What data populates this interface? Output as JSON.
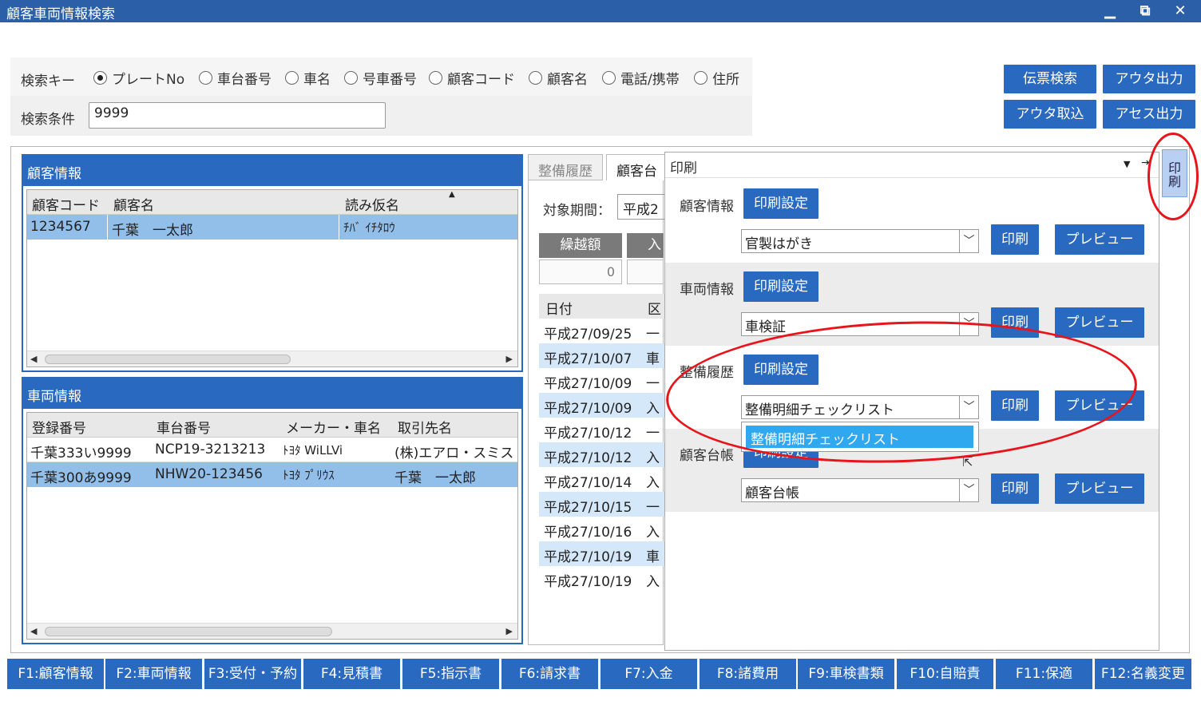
{
  "window": {
    "title": "顧客車両情報検索",
    "minimize": "▁",
    "restore": "⧉",
    "close": "✕"
  },
  "search": {
    "key_label": "検索キー",
    "options": [
      "プレートNo",
      "車台番号",
      "車名",
      "号車番号",
      "顧客コード",
      "顧客名",
      "電話/携帯",
      "住所"
    ],
    "selected": "プレートNo",
    "cond_label": "検索条件",
    "cond_value": "9999"
  },
  "top_buttons": {
    "denpyo": "伝票検索",
    "outer_out": "アウタ出力",
    "outer_in": "アウタ取込",
    "access_out": "アセス出力"
  },
  "customer": {
    "title": "顧客情報",
    "columns": [
      "顧客コード",
      "顧客名",
      "読み仮名"
    ],
    "rows": [
      {
        "code": "1234567",
        "name": "千葉　一太郎",
        "kana": "ﾁﾊﾞ ｲﾁﾀﾛｳ"
      }
    ]
  },
  "vehicle": {
    "title": "車両情報",
    "columns": [
      "登録番号",
      "車台番号",
      "メーカー・車名",
      "取引先名"
    ],
    "rows": [
      {
        "reg": "千葉333い9999",
        "chassis": "NCP19-3213213",
        "maker": "ﾄﾖﾀ WiLLVi",
        "client": "(株)エアロ・スミス"
      },
      {
        "reg": "千葉300あ9999",
        "chassis": "NHW20-123456",
        "maker": "ﾄﾖﾀ ﾌﾟﾘｳｽ",
        "client": "千葉　一太郎"
      }
    ]
  },
  "middle": {
    "tabs": [
      "整備履歴",
      "顧客台"
    ],
    "period_label": "対象期間：",
    "period_value": "平成2",
    "carry_label": "繰越額",
    "in_label": "入",
    "carry_value": "0",
    "col_date": "日付",
    "col_kind": "区",
    "dates": [
      "平成27/09/25",
      "平成27/10/07",
      "平成27/10/09",
      "平成27/10/09",
      "平成27/10/12",
      "平成27/10/12",
      "平成27/10/14",
      "平成27/10/15",
      "平成27/10/16",
      "平成27/10/19",
      "平成27/10/19"
    ],
    "kinds": [
      "一",
      "車",
      "一",
      "入",
      "一",
      "入",
      "入",
      "一",
      "入",
      "車",
      "入"
    ]
  },
  "print": {
    "title": "印刷",
    "side_tab": "印刷",
    "settings_label": "印刷設定",
    "print_label": "印刷",
    "preview_label": "プレビュー",
    "sections": [
      {
        "label": "顧客情報",
        "value": "官製はがき"
      },
      {
        "label": "車両情報",
        "value": "車検証"
      },
      {
        "label": "整備履歴",
        "value": "整備明細チェックリスト"
      },
      {
        "label": "顧客台帳",
        "value": "顧客台帳"
      }
    ],
    "dropdown_item": "整備明細チェックリスト"
  },
  "fkeys": [
    "F1:顧客情報",
    "F2:車両情報",
    "F3:受付・予約",
    "F4:見積書",
    "F5:指示書",
    "F6:請求書",
    "F7:入金",
    "F8:諸費用",
    "F9:車検書類",
    "F10:自賠責",
    "F11:保適",
    "F12:名義変更"
  ],
  "colors": {
    "accent": "#2a69c0",
    "title_bar": "#2b5fa8",
    "selection": "#92bfea",
    "highlight": "#e8141c"
  }
}
